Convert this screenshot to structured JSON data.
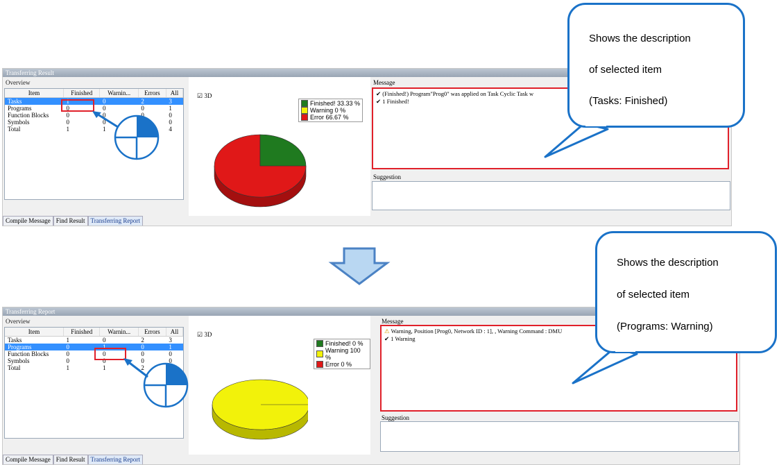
{
  "top": {
    "title": "Transferring Result",
    "overview_label": "Overview",
    "columns": [
      "Item",
      "Finished",
      "Warnin...",
      "Errors",
      "All"
    ],
    "rows": [
      [
        "Tasks",
        "1",
        "0",
        "2",
        "3"
      ],
      [
        "Programs",
        "0",
        "0",
        "0",
        "1"
      ],
      [
        "Function Blocks",
        "0",
        "0",
        "0",
        "0"
      ],
      [
        "Symbols",
        "0",
        "0",
        "0",
        "0"
      ],
      [
        "Total",
        "1",
        "1",
        "2",
        "4"
      ]
    ],
    "selected_row": 0,
    "checkbox_label": "3D",
    "legend": [
      "Finished! 33.33 %",
      "Warning 0 %",
      "Error 66.67 %"
    ],
    "message_label": "Message",
    "messages": [
      "✔ (Finished!) Program\"Prog0\" was applied on Task Cyclic Task w",
      "✔ 1 Finished!"
    ],
    "suggestion_label": "Suggestion",
    "tabs": [
      "Compile Message",
      "Find Result",
      "Transferring Report"
    ],
    "callout": [
      "Shows the description",
      "of selected item",
      "(Tasks: Finished)"
    ]
  },
  "bottom": {
    "title": "Transferring Report",
    "overview_label": "Overview",
    "columns": [
      "Item",
      "Finished",
      "Warnin...",
      "Errors",
      "All"
    ],
    "rows": [
      [
        "Tasks",
        "1",
        "0",
        "2",
        "3"
      ],
      [
        "Programs",
        "0",
        "1",
        "0",
        "1"
      ],
      [
        "Function Blocks",
        "0",
        "0",
        "0",
        "0"
      ],
      [
        "Symbols",
        "0",
        "0",
        "0",
        "0"
      ],
      [
        "Total",
        "1",
        "1",
        "2",
        "4"
      ]
    ],
    "selected_row": 1,
    "checkbox_label": "3D",
    "legend": [
      "Finished! 0 %",
      "Warning 100 %",
      "Error 0 %"
    ],
    "message_label": "Message",
    "messages": [
      "Warning, Position [Prog0, Network ID : 1], , Warning Command : DMU",
      "✔ 1 Warning"
    ],
    "suggestion_label": "Suggestion",
    "tabs": [
      "Compile Message",
      "Find Result",
      "Transferring Report"
    ],
    "callout": [
      "Shows the description",
      "of selected item",
      "(Programs: Warning)"
    ]
  },
  "colors": {
    "finished": "#1f7a1f",
    "warning": "#f2f20a",
    "error": "#e01818",
    "accent": "#1a72c8"
  },
  "icons": {
    "arrow": "down-arrow-icon",
    "pie_indicator": "pie-indicator-icon",
    "check": "check-icon"
  }
}
